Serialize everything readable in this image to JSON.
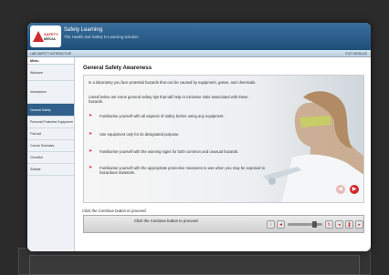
{
  "header": {
    "logo_line1": "SAFETY",
    "logo_line2": "MEDIA",
    "title": "Safety Learning",
    "subtitle": "The Health and Safety E-Learning Solution"
  },
  "subbar": {
    "left": "LAB SAFETY INTERACTIVE",
    "right": "EXIT MODULE"
  },
  "sidebar": {
    "heading": "Menu",
    "items": [
      {
        "label": "Welcome"
      },
      {
        "label": "Introduction"
      },
      {
        "label": "General Safety"
      },
      {
        "label": "Personal Protective Equipment"
      },
      {
        "label": "First aid"
      },
      {
        "label": "Course Summary"
      },
      {
        "label": "Checklist"
      },
      {
        "label": "Sidebar"
      }
    ],
    "active_index": 2
  },
  "content": {
    "title": "General Safety Awareness",
    "intro1": "In a laboratory you face potential hazards that can be caused by equipment, gases, and chemicals.",
    "intro2": "Listed below are some general safety tips that will help to minimise risks associated with these hazards.",
    "bullets": [
      "Familiarise yourself with all aspects of safety before using any equipment.",
      "Use equipment only for its designated purpose.",
      "Familiarise yourself with the warning signs for both common and unusual hazards.",
      "Familiarise yourself with the appropriate protective measures to use when you may be exposed to hazardous materials."
    ],
    "instruction": "Click the Continue button to proceed."
  },
  "player": {
    "caption": "Click the Continue button to proceed.",
    "progress": 0.7
  },
  "colors": {
    "accent": "#d12a2a",
    "header": "#1f4e7a",
    "active_menu": "#2f5f8a"
  },
  "icons": [
    "back-arrow-icon",
    "next-arrow-icon",
    "info-icon",
    "volume-icon",
    "replay-icon",
    "rewind-icon",
    "pause-icon",
    "forward-icon"
  ]
}
